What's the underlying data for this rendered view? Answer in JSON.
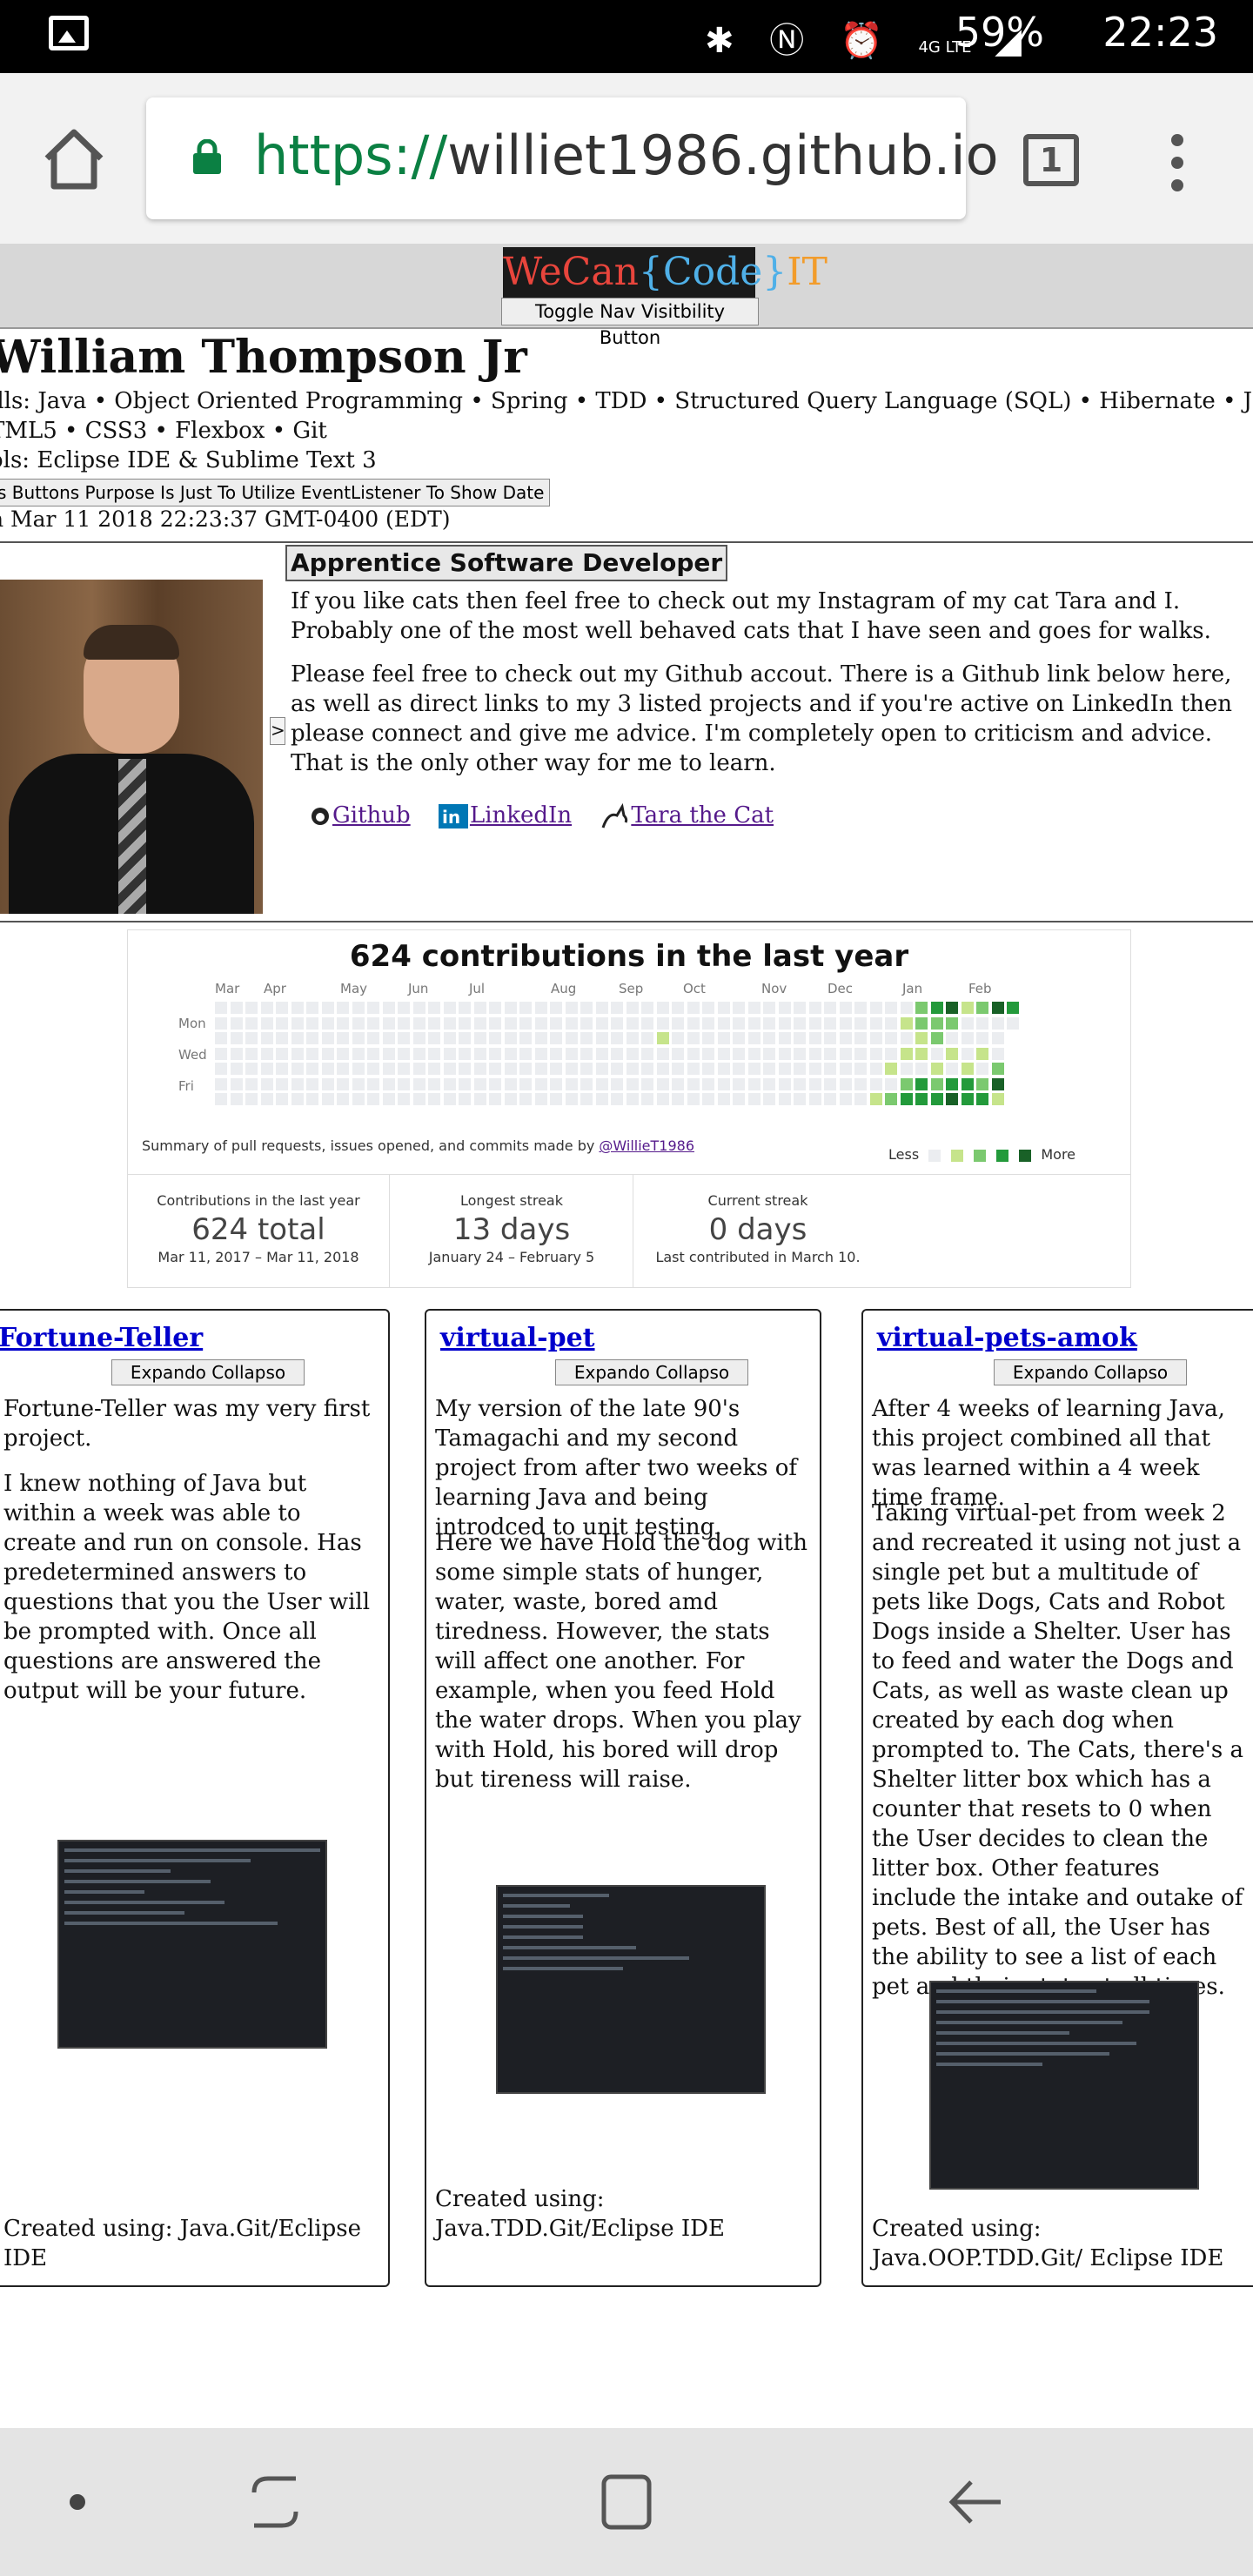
{
  "status_bar": {
    "time": "22:23",
    "battery": "59%",
    "network": "4G LTE"
  },
  "browser": {
    "url_scheme": "https://",
    "url_host": "williet1986.github.io",
    "tab_count": "1"
  },
  "site": {
    "logo_we": "WeCan",
    "logo_code": "{Code}",
    "logo_it": "IT",
    "nav_toggle_label": "Toggle Nav Visitbility Button",
    "name": "William Thompson Jr",
    "skills_line1": "ills: Java • Object Oriented Programming • Spring • TDD • Structured Query Language (SQL) • Hibernate • JavaScript • jQuery",
    "skills_line2": "TML5 • CSS3 • Flexbox • Git",
    "tools_line": "ols: Eclipse IDE & Sublime Text 3",
    "date_button_label": "s Buttons Purpose Is Just To Utilize EventListener To Show Date",
    "date_text": "n Mar 11 2018 22:23:37 GMT-0400 (EDT)",
    "job_title": "Apprentice Software Developer",
    "bio1": "If you like cats then feel free to check out my Instagram of my cat Tara and I. Probably one of the most well behaved cats that I have seen and goes for walks.",
    "bio2": "Please feel free to check out my Github accout. There is a Github link below here, as well as direct links to my 3 listed projects and if you're active on LinkedIn then please connect and give me advice. I'm completely open to criticism and advice. That is the only other way for me to learn.",
    "links": {
      "github": "Github",
      "linkedin": "LinkedIn",
      "tara": "Tara the Cat"
    },
    "collapse_arrow": ">"
  },
  "contributions": {
    "title": "624 contributions in the last year",
    "months": [
      "Mar",
      "Apr",
      "May",
      "Jun",
      "Jul",
      "Aug",
      "Sep",
      "Oct",
      "Nov",
      "Dec",
      "Jan",
      "Feb"
    ],
    "days": [
      "Mon",
      "Wed",
      "Fri"
    ],
    "summary_prefix": "Summary of pull requests, issues opened, and commits made by ",
    "summary_user": "@WillieT1986",
    "legend_less": "Less",
    "legend_more": "More",
    "level_colors": [
      "#ebedf0",
      "#c6e48b",
      "#7bc96f",
      "#239a3b",
      "#196127"
    ],
    "stats": [
      {
        "label": "Contributions in the last year",
        "value": "624 total",
        "sub": "Mar 11, 2017 – Mar 11, 2018"
      },
      {
        "label": "Longest streak",
        "value": "13 days",
        "sub": "January 24 – February 5"
      },
      {
        "label": "Current streak",
        "value": "0 days",
        "sub": "Last contributed in March 10."
      }
    ]
  },
  "projects": [
    {
      "title": "Fortune-Teller",
      "button": "Expando Collapso",
      "p1": "Fortune-Teller was my very first project.",
      "p2": "I knew nothing of Java but within a week was able to create and run on console. Has predetermined answers to questions that you the User will be prompted with. Once all questions are answered the output will be your future.",
      "footer": "Created using: Java.Git/Eclipse IDE"
    },
    {
      "title": "virtual-pet",
      "button": "Expando Collapso",
      "p1": "My version of the late 90's Tamagachi and my second project from after two weeks of learning Java and being introdced to unit testing.",
      "p2": "Here we have Hold the dog with some simple stats of hunger, water, waste, bored amd tiredness. However, the stats will affect one another. For example, when you feed Hold the water drops. When you play with Hold, his bored will drop but tireness will raise.",
      "footer": "Created using: Java.TDD.Git/Eclipse IDE"
    },
    {
      "title": "virtual-pets-amok",
      "button": "Expando Collapso",
      "p1": "After 4 weeks of learning Java, this project combined all that was learned within a 4 week time frame.",
      "p2": "Taking virtual-pet from week 2 and recreated it using not just a single pet but a multitude of pets like Dogs, Cats and Robot Dogs inside a Shelter. User has to feed and water the Dogs and Cats, as well as waste clean up created by each dog when prompted to. The Cats, there's a Shelter litter box which has a counter that resets to 0 when the User decides to clean the litter box. Other features include the intake and outake of pets. Best of all, the User has the ability to see a list of each pet and their stats at all times.",
      "footer": "Created using: Java.OOP.TDD.Git/ Eclipse IDE"
    }
  ]
}
